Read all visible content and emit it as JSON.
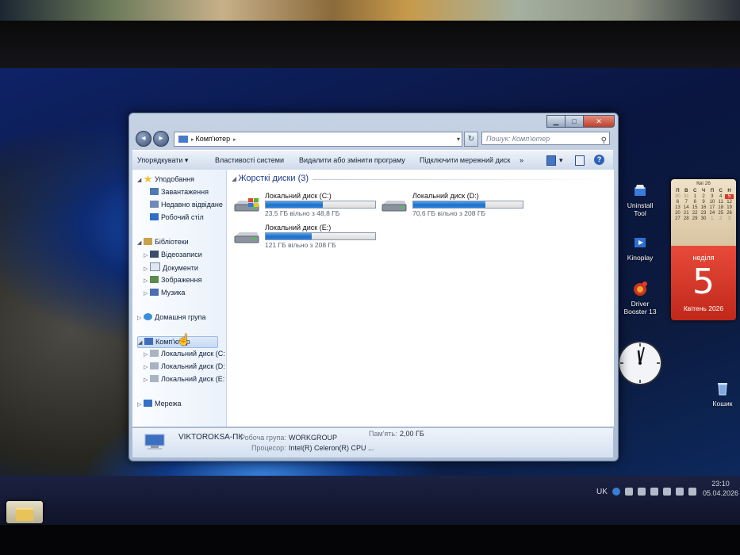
{
  "window": {
    "address": "Комп'ютер",
    "address_arrow": "▸",
    "search_placeholder": "Пошук: Комп'ютер",
    "controls": {
      "minimize": "▁",
      "maximize": "□",
      "close": "✕"
    }
  },
  "toolbar": {
    "organize": "Упорядкувати",
    "organize_arrow": "▾",
    "system_properties": "Властивості системи",
    "uninstall": "Видалити або змінити програму",
    "map_drive": "Підключити мережний диск",
    "more": "»",
    "view_arrow": "▾",
    "help": "?"
  },
  "nav": {
    "favorites": "Уподобання",
    "downloads": "Завантаження",
    "recent": "Недавно відвідане",
    "desktop": "Робочий стіл",
    "libraries": "Бібліотеки",
    "videos": "Відеозаписи",
    "documents": "Документи",
    "pictures": "Зображення",
    "music": "Музика",
    "homegroup": "Домашня група",
    "computer": "Комп'ютер",
    "drive_c": "Локальний диск (C:",
    "drive_d": "Локальний диск (D:",
    "drive_e": "Локальний диск (E:",
    "network": "Мережа"
  },
  "content": {
    "group_header": "Жорсткі диски (3)",
    "drives": [
      {
        "name": "Локальний диск (C:)",
        "free_text": "23,5 ГБ вільно з 48,8 ГБ",
        "used_fraction": 0.52,
        "system": true
      },
      {
        "name": "Локальний диск (D:)",
        "free_text": "70,6 ГБ вільно з 208 ГБ",
        "used_fraction": 0.66,
        "system": false
      },
      {
        "name": "Локальний диск (E:)",
        "free_text": "121 ГБ вільно з 208 ГБ",
        "used_fraction": 0.42,
        "system": false
      }
    ]
  },
  "details": {
    "pc_name": "VIKTOROKSA-ПК",
    "workgroup_label": "Робоча група:",
    "workgroup_value": "WORKGROUP",
    "memory_label": "Пам'ять:",
    "memory_value": "2,00 ГБ",
    "cpu_label": "Процесор:",
    "cpu_value": "Intel(R) Celeron(R) CPU ..."
  },
  "desktop_icons": {
    "uninstall_tool": "Uninstall Tool",
    "kinoplay": "Kinoplay",
    "driver_booster": "Driver Booster 13",
    "recycle_bin": "Кошик"
  },
  "calendar": {
    "month_header": "Кві 26",
    "weekdays": [
      "П",
      "В",
      "С",
      "Ч",
      "П",
      "С",
      "Н"
    ],
    "weeks": [
      [
        "30",
        "31",
        "1",
        "2",
        "3",
        "4",
        "5"
      ],
      [
        "6",
        "7",
        "8",
        "9",
        "10",
        "11",
        "12"
      ],
      [
        "13",
        "14",
        "15",
        "16",
        "17",
        "18",
        "19"
      ],
      [
        "20",
        "21",
        "22",
        "23",
        "24",
        "25",
        "26"
      ],
      [
        "27",
        "28",
        "29",
        "30",
        "1",
        "2",
        "3"
      ]
    ],
    "day_name": "неділя",
    "day_number": "5",
    "month_year": "Квітень 2026"
  },
  "tray": {
    "language": "UK",
    "time": "23:10",
    "date": "05.04.2026"
  },
  "colors": {
    "progress_fill": "#2a82dc",
    "calendar_red": "#d83a2a",
    "group_header": "#1e3a8a"
  }
}
